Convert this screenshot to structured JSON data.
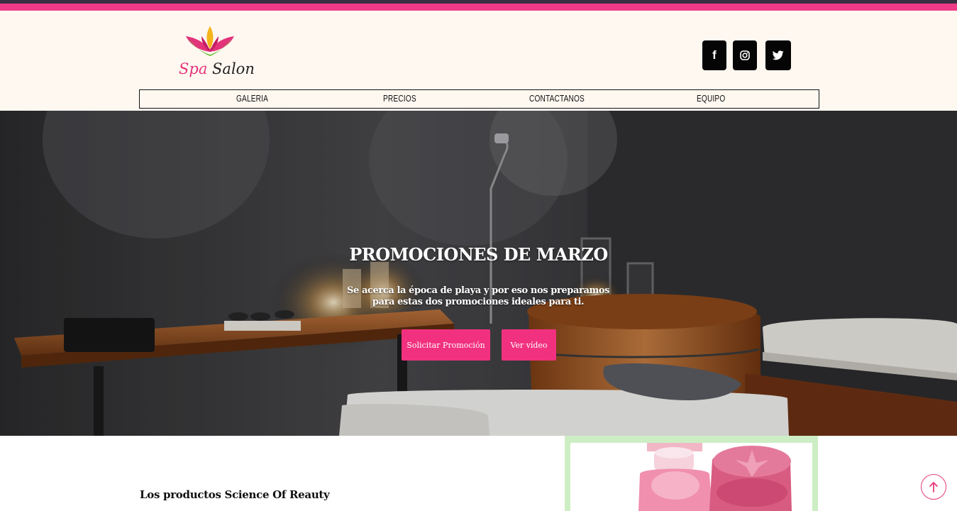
{
  "brand": {
    "logo_part1": "Spa",
    "logo_part2": "Salon"
  },
  "social": {
    "facebook_glyph": "f",
    "icons": [
      "facebook-icon",
      "instagram-icon",
      "twitter-icon"
    ]
  },
  "nav": {
    "items": [
      {
        "label": "GALERIA"
      },
      {
        "label": "PRECIOS"
      },
      {
        "label": "CONTACTANOS"
      },
      {
        "label": "EQUIPO"
      }
    ]
  },
  "hero": {
    "title": "PROMOCIONES DE MARZO",
    "subtitle": "Se acerca la época de playa y por eso nos preparamos para estas dos promociones ideales para ti.",
    "primary_button": "Solicitar Promoción",
    "secondary_button": "Ver vídeo"
  },
  "products": {
    "heading": "Los productos Science Of Reauty"
  },
  "colors": {
    "accent": "#f1317f",
    "header_bg": "#fff8f0",
    "top_bar": "#ef3a86",
    "product_frame": "#cdeec4"
  }
}
